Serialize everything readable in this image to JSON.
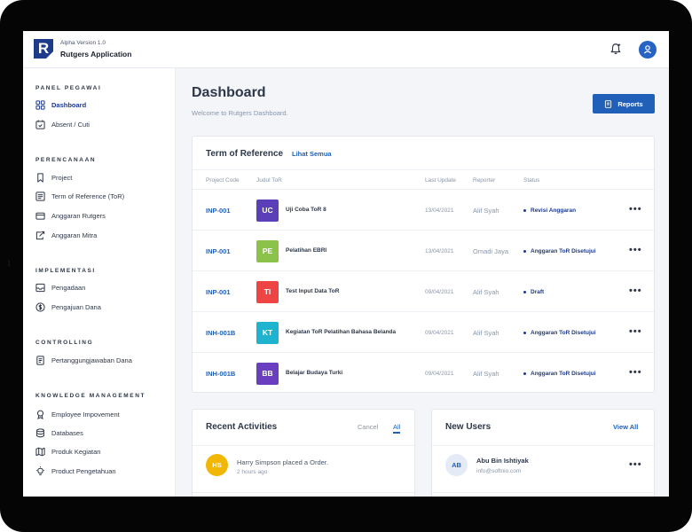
{
  "app": {
    "version": "Alpha Version 1.0",
    "name": "Rutgers Application",
    "logo_letter": "R"
  },
  "header": {
    "notification_icon": "bell-icon",
    "profile_icon": "user-avatar"
  },
  "sidebar": {
    "sections": [
      {
        "title": "PANEL PEGAWAI",
        "items": [
          {
            "label": "Dashboard",
            "icon": "grid-icon",
            "active": true
          },
          {
            "label": "Absent / Cuti",
            "icon": "calendar-check-icon"
          }
        ]
      },
      {
        "title": "PERENCANAAN",
        "items": [
          {
            "label": "Project",
            "icon": "bookmark-icon"
          },
          {
            "label": "Term of Reference (ToR)",
            "icon": "list-icon"
          },
          {
            "label": "Anggaran Rutgers",
            "icon": "wallet-icon"
          },
          {
            "label": "Anggaran Mitra",
            "icon": "share-icon"
          }
        ]
      },
      {
        "title": "IMPLEMENTASI",
        "items": [
          {
            "label": "Pengadaan",
            "icon": "inbox-icon"
          },
          {
            "label": "Pengajuan Dana",
            "icon": "dollar-icon"
          }
        ]
      },
      {
        "title": "CONTROLLING",
        "items": [
          {
            "label": "Pertanggungjawaban Dana",
            "icon": "document-icon"
          }
        ]
      },
      {
        "title": "KNOWLEDGE MANAGEMENT",
        "items": [
          {
            "label": "Employee Impovement",
            "icon": "award-icon"
          },
          {
            "label": "Databases",
            "icon": "database-icon"
          },
          {
            "label": "Produk Kegiatan",
            "icon": "map-icon"
          },
          {
            "label": "Product Pengetahuan",
            "icon": "lightbulb-icon"
          }
        ]
      }
    ]
  },
  "main": {
    "title": "Dashboard",
    "subtitle": "Welcome to Rutgers Dashboard.",
    "reports_button": "Reports"
  },
  "tor": {
    "title": "Term of Reference",
    "see_all": "Lihat Semua",
    "columns": [
      "Project Code",
      "Judul ToR",
      "Last Update",
      "Reporter",
      "Status"
    ],
    "rows": [
      {
        "code": "INP-001",
        "initials": "UC",
        "color": "#5b3fb8",
        "title": "Uji Coba ToR 8",
        "date": "13/04/2021",
        "reporter": "Alif Syah",
        "status": "Revisi Anggaran"
      },
      {
        "code": "INP-001",
        "initials": "PE",
        "color": "#8bc34a",
        "title": "Pelatihan EBRI",
        "date": "13/04/2021",
        "reporter": "Omadi Jaya",
        "status": "Anggaran ToR Disetujui"
      },
      {
        "code": "INP-001",
        "initials": "TI",
        "color": "#ef4444",
        "title": "Test Input Data ToR",
        "date": "09/04/2021",
        "reporter": "Alif Syah",
        "status": "Draft"
      },
      {
        "code": "INH-001B",
        "initials": "KT",
        "color": "#1fb3cf",
        "title": "Kegiatan ToR Pelatihan Bahasa Belanda",
        "date": "09/04/2021",
        "reporter": "Alif Syah",
        "status": "Anggaran ToR Disetujui"
      },
      {
        "code": "INH-001B",
        "initials": "BB",
        "color": "#6a3fbf",
        "title": "Belajar Budaya Turki",
        "date": "09/04/2021",
        "reporter": "Alif Syah",
        "status": "Anggaran ToR Disetujui"
      }
    ]
  },
  "activities": {
    "title": "Recent Activities",
    "tab_cancel": "Cancel",
    "tab_all": "All",
    "items": [
      {
        "initials": "HS",
        "text": "Harry Simpson placed a Order.",
        "time": "2 hours ago"
      }
    ]
  },
  "users": {
    "title": "New Users",
    "view_all": "View All",
    "items": [
      {
        "initials": "AB",
        "name": "Abu Bin Ishtiyak",
        "email": "info@softnio.com"
      }
    ]
  },
  "colors": {
    "primary": "#2160b8",
    "navy": "#1e3a8a",
    "background": "#f3f5f9"
  }
}
